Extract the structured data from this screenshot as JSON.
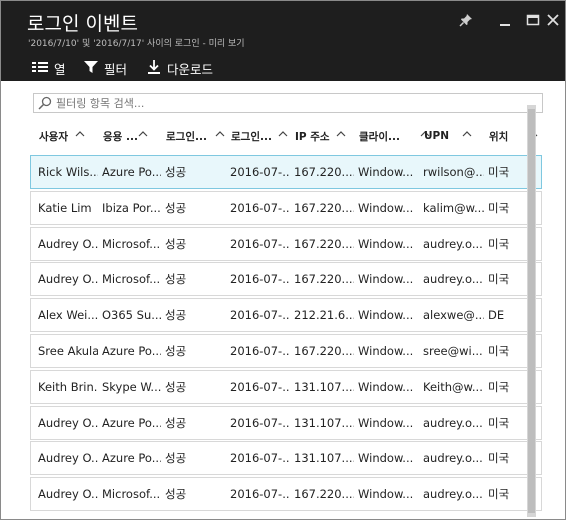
{
  "title": "로그인 이벤트",
  "subtitle": "'2016/7/10' 및 '2016/7/17' 사이의 로그인 - 미리 보기",
  "icons": {
    "pin": "pin-icon",
    "maximize": "maximize-icon",
    "close": "close-icon",
    "columns": "columns-icon",
    "filter": "filter-icon",
    "download": "download-icon",
    "search": "search-icon",
    "sort": "sort-caret-up-icon"
  },
  "toolbar": {
    "columns_label": "열",
    "filter_label": "필터",
    "download_label": "다운로드"
  },
  "search": {
    "placeholder": "필터링 항목 검색..."
  },
  "columns": [
    "사용자",
    "응용 ...",
    "로그인...",
    "로그인...",
    "IP 주소",
    "클라이...",
    "UPN",
    "위치"
  ],
  "rows": [
    [
      "Rick Wils...",
      "Azure Po...",
      "성공",
      "2016-07-...",
      "167.220....",
      "Window...",
      "rwilson@...",
      "미국"
    ],
    [
      "Katie Lim",
      "Ibiza Por...",
      "성공",
      "2016-07-...",
      "167.220....",
      "Window...",
      "kalim@w...",
      "미국"
    ],
    [
      "Audrey O...",
      "Microsof...",
      "성공",
      "2016-07-...",
      "167.220....",
      "Window...",
      "audrey.o...",
      "미국"
    ],
    [
      "Audrey O...",
      "Microsof...",
      "성공",
      "2016-07-...",
      "167.220....",
      "Window...",
      "audrey.o...",
      "미국"
    ],
    [
      "Alex Wei...",
      "O365 Su...",
      "성공",
      "2016-07-...",
      "212.21.6...",
      "Window...",
      "alexwe@...",
      "DE"
    ],
    [
      "Sree Akula",
      "Azure Po...",
      "성공",
      "2016-07-...",
      "167.220....",
      "Window...",
      "sree@wi...",
      "미국"
    ],
    [
      "Keith Brin...",
      "Skype W...",
      "성공",
      "2016-07-...",
      "131.107....",
      "Window...",
      "Keith@w...",
      "미국"
    ],
    [
      "Audrey O...",
      "Azure Po...",
      "성공",
      "2016-07-...",
      "131.107....",
      "Window...",
      "audrey.o...",
      "미국"
    ],
    [
      "Audrey O...",
      "Azure Po...",
      "성공",
      "2016-07-...",
      "131.107....",
      "Window...",
      "audrey.o...",
      "미국"
    ],
    [
      "Audrey O...",
      "Microsof...",
      "성공",
      "2016-07-...",
      "167.220....",
      "Window...",
      "audrey.o...",
      "미국"
    ]
  ],
  "selected_row": 0,
  "colors": {
    "header_bg": "#1e1e1e",
    "selected_row_bg": "#e8f7fb",
    "selected_row_border": "#7fc8e0"
  }
}
